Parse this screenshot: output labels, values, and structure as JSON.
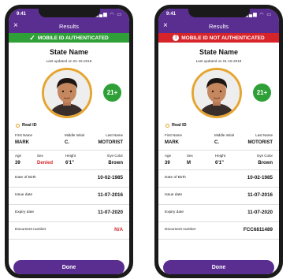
{
  "colors": {
    "brand": "#5a2d91",
    "success": "#2fa037",
    "error": "#d7242b",
    "accent": "#e6a530"
  },
  "phones": [
    {
      "status_time": "9:41",
      "nav_title": "Results",
      "close_icon": "×",
      "banner_icon": "✓",
      "banner_text": "MOBILE ID AUTHENTICATED",
      "state_name": "State Name",
      "last_updated": "Last updated on 01-15-2019",
      "age_badge": "21+",
      "real_id_label": "Real ID",
      "name_labels": {
        "first": "First Name",
        "middle": "Middle Initial",
        "last": "Last Name"
      },
      "name_values": {
        "first": "MARK",
        "middle": "C.",
        "last": "MOTORIST"
      },
      "attr_labels": {
        "age": "Age",
        "sex": "Sex",
        "height": "Height",
        "eye": "Eye Color"
      },
      "attr_values": {
        "age": "39",
        "sex": "Denied",
        "height": "6'1\"",
        "eye": "Brown"
      },
      "fields": [
        {
          "label": "Date of Birth",
          "value": "10-02-1985"
        },
        {
          "label": "Issue date",
          "value": "11-07-2016"
        },
        {
          "label": "Expiry date",
          "value": "11-07-2020"
        },
        {
          "label": "Document number",
          "value": "N/A"
        }
      ],
      "done_label": "Done"
    },
    {
      "status_time": "9:41",
      "nav_title": "Results",
      "close_icon": "×",
      "banner_icon": "!",
      "banner_text": "MOBILE ID NOT AUTHENTICATED",
      "state_name": "State Name",
      "last_updated": "Last updated on 01-15-2019",
      "age_badge": "21+",
      "real_id_label": "Real ID",
      "name_labels": {
        "first": "First Name",
        "middle": "Middle Initial",
        "last": "Last Name"
      },
      "name_values": {
        "first": "MARK",
        "middle": "C.",
        "last": "MOTORIST"
      },
      "attr_labels": {
        "age": "Age",
        "sex": "Sex",
        "height": "Height",
        "eye": "Eye Color"
      },
      "attr_values": {
        "age": "39",
        "sex": "M",
        "height": "6'1\"",
        "eye": "Brown"
      },
      "fields": [
        {
          "label": "Date of Birth",
          "value": "10-02-1985"
        },
        {
          "label": "Issue date",
          "value": "11-07-2016"
        },
        {
          "label": "Expiry date",
          "value": "11-07-2020"
        },
        {
          "label": "Document number",
          "value": "FCC6811489"
        }
      ],
      "done_label": "Done"
    }
  ]
}
